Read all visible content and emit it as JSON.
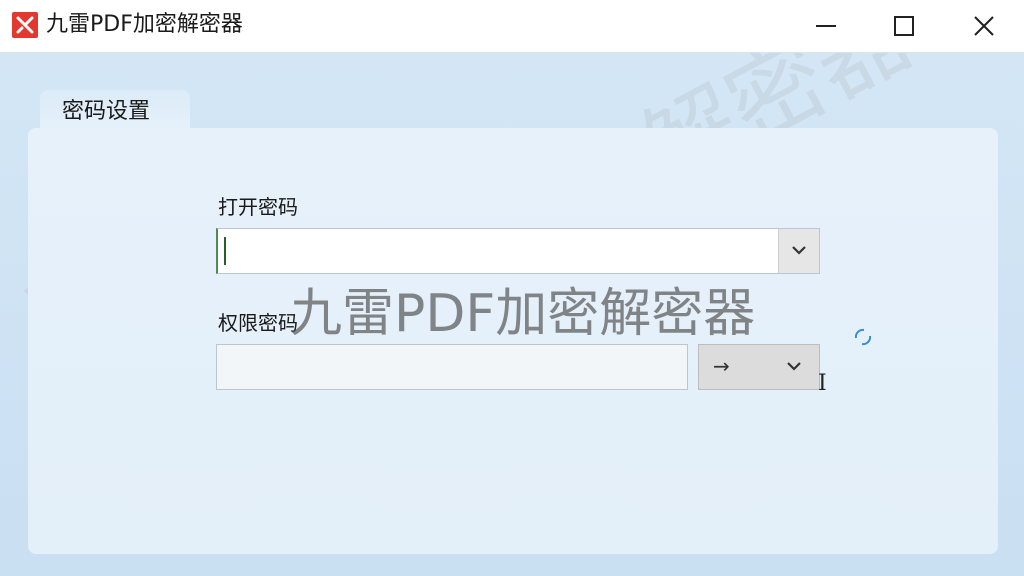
{
  "window": {
    "title": "九雷PDF加密解密器",
    "icon": "app-logo-icon",
    "accent_color": "#e2382f",
    "controls": {
      "minimize_icon": "minimize-icon",
      "maximize_icon": "maximize-icon",
      "close_icon": "close-icon"
    }
  },
  "tabs": [
    {
      "label": "密码设置",
      "active": true
    }
  ],
  "form": {
    "open_password": {
      "label": "打开密码",
      "value": "",
      "dropdown_icon": "chevron-down-icon"
    },
    "permission_password": {
      "label": "权限密码",
      "value": "",
      "select_value": "→",
      "dropdown_icon": "chevron-down-icon"
    }
  },
  "watermark": {
    "text": "九雷PDF加密解密器"
  }
}
